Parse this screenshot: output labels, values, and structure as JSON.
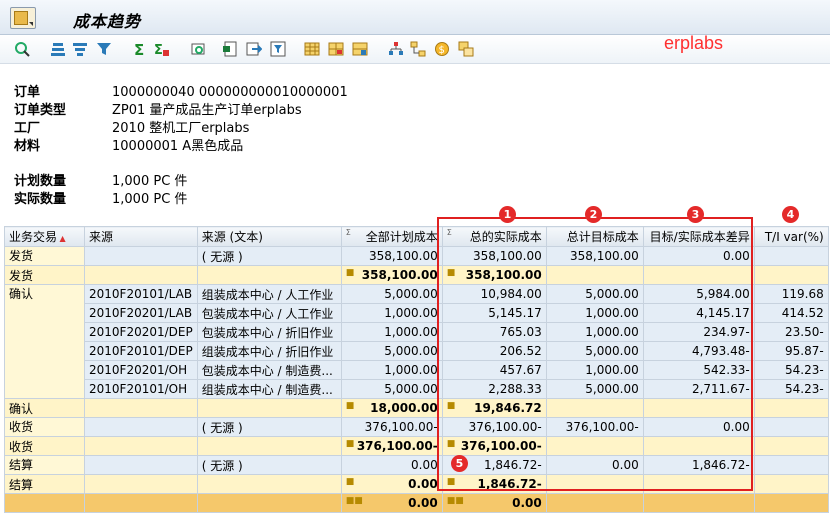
{
  "window": {
    "title": "成本趋势"
  },
  "watermark": "erplabs",
  "header": {
    "order_label": "订单",
    "order_value": "1000000040 000000000010000001",
    "order_type_label": "订单类型",
    "order_type_value": "ZP01 量产成品生产订单erplabs",
    "plant_label": "工厂",
    "plant_value": "2010 整机工厂erplabs",
    "material_label": "材料",
    "material_value": "10000001 A黑色成品",
    "planned_qty_label": "计划数量",
    "planned_qty_value": "1,000 PC 件",
    "actual_qty_label": "实际数量",
    "actual_qty_value": "1,000 PC 件"
  },
  "columns": {
    "business_txn": "业务交易",
    "source": "来源",
    "source_text": "来源 (文本)",
    "total_plan": "全部计划成本",
    "total_actual": "总的实际成本",
    "total_target": "总计目标成本",
    "variance": "目标/实际成本差异",
    "ti_var": "T/I var(%)"
  },
  "rows": {
    "issue_detail": {
      "src_text": "( 无源 )",
      "plan": "358,100.00",
      "actual": "358,100.00",
      "target": "358,100.00",
      "var": "0.00"
    },
    "issue_sub": {
      "label": "发货",
      "plan": "358,100.00",
      "actual": "358,100.00"
    },
    "confirm": [
      {
        "src": "2010F20101/LAB",
        "src_text": "组装成本中心 / 人工作业",
        "plan": "5,000.00",
        "actual": "10,984.00",
        "target": "5,000.00",
        "var": "5,984.00",
        "ti": "119.68"
      },
      {
        "src": "2010F20201/LAB",
        "src_text": "包装成本中心 / 人工作业",
        "plan": "1,000.00",
        "actual": "5,145.17",
        "target": "1,000.00",
        "var": "4,145.17",
        "ti": "414.52"
      },
      {
        "src": "2010F20201/DEP",
        "src_text": "包装成本中心 / 折旧作业",
        "plan": "1,000.00",
        "actual": "765.03",
        "target": "1,000.00",
        "var": "234.97-",
        "ti": "23.50-"
      },
      {
        "src": "2010F20101/DEP",
        "src_text": "组装成本中心 / 折旧作业",
        "plan": "5,000.00",
        "actual": "206.52",
        "target": "5,000.00",
        "var": "4,793.48-",
        "ti": "95.87-"
      },
      {
        "src": "2010F20201/OH",
        "src_text": "包装成本中心 / 制造费...",
        "plan": "1,000.00",
        "actual": "457.67",
        "target": "1,000.00",
        "var": "542.33-",
        "ti": "54.23-"
      },
      {
        "src": "2010F20101/OH",
        "src_text": "组装成本中心 / 制造费...",
        "plan": "5,000.00",
        "actual": "2,288.33",
        "target": "5,000.00",
        "var": "2,711.67-",
        "ti": "54.23-"
      }
    ],
    "confirm_sub": {
      "label": "确认",
      "plan": "18,000.00",
      "actual": "19,846.72"
    },
    "receipt_detail": {
      "src_text": "( 无源 )",
      "plan": "376,100.00-",
      "actual": "376,100.00-",
      "target": "376,100.00-",
      "var": "0.00"
    },
    "receipt_sub": {
      "label": "收货",
      "plan": "376,100.00-",
      "actual": "376,100.00-"
    },
    "settle_detail": {
      "src_text": "( 无源 )",
      "plan": "0.00",
      "actual": "1,846.72-",
      "target": "0.00",
      "var": "1,846.72-"
    },
    "settle_sub": {
      "label": "结算",
      "plan": "0.00",
      "actual": "1,846.72-"
    },
    "grand_total": {
      "plan": "0.00",
      "actual": "0.00"
    }
  },
  "txn_labels": {
    "issue": "发货",
    "confirm": "确认",
    "receipt": "收货",
    "settle": "结算"
  },
  "badges": [
    "1",
    "2",
    "3",
    "4",
    "5"
  ],
  "colors": {
    "badge": "#e42a2a",
    "highlight_box": "#e02020",
    "subtotal_row": "#fff4c8",
    "total_row": "#f5c86b"
  }
}
